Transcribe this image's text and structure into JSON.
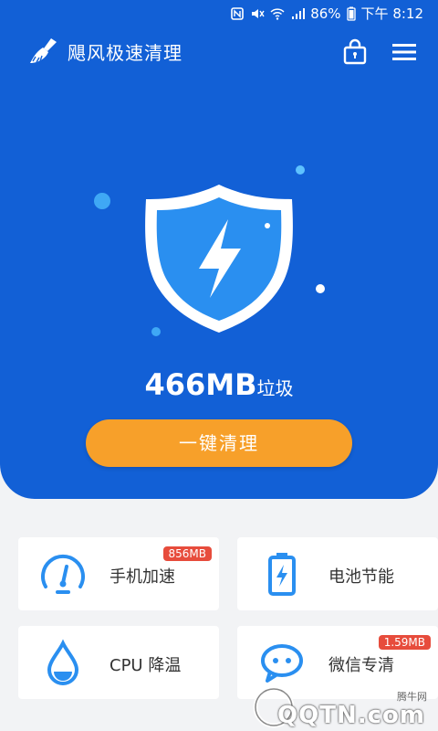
{
  "status_bar": {
    "battery": "86%",
    "time": "下午 8:12"
  },
  "app": {
    "title": "飓风极速清理"
  },
  "hero": {
    "junk_value": "466MB",
    "junk_unit": "垃圾",
    "clean_button": "一键清理"
  },
  "features": [
    {
      "label": "手机加速",
      "badge": "856MB",
      "icon": "speedometer-icon"
    },
    {
      "label": "电池节能",
      "badge": "",
      "icon": "battery-icon"
    },
    {
      "label": "CPU 降温",
      "badge": "",
      "icon": "water-drop-icon"
    },
    {
      "label": "微信专清",
      "badge": "1.59MB",
      "icon": "chat-bubble-icon"
    }
  ],
  "watermark": {
    "small": "腾牛网",
    "big": "QQTN.com"
  },
  "colors": {
    "primary": "#1260d6",
    "accent": "#f7a02a",
    "badge": "#e74c3c",
    "icon": "#2a8ff0"
  }
}
